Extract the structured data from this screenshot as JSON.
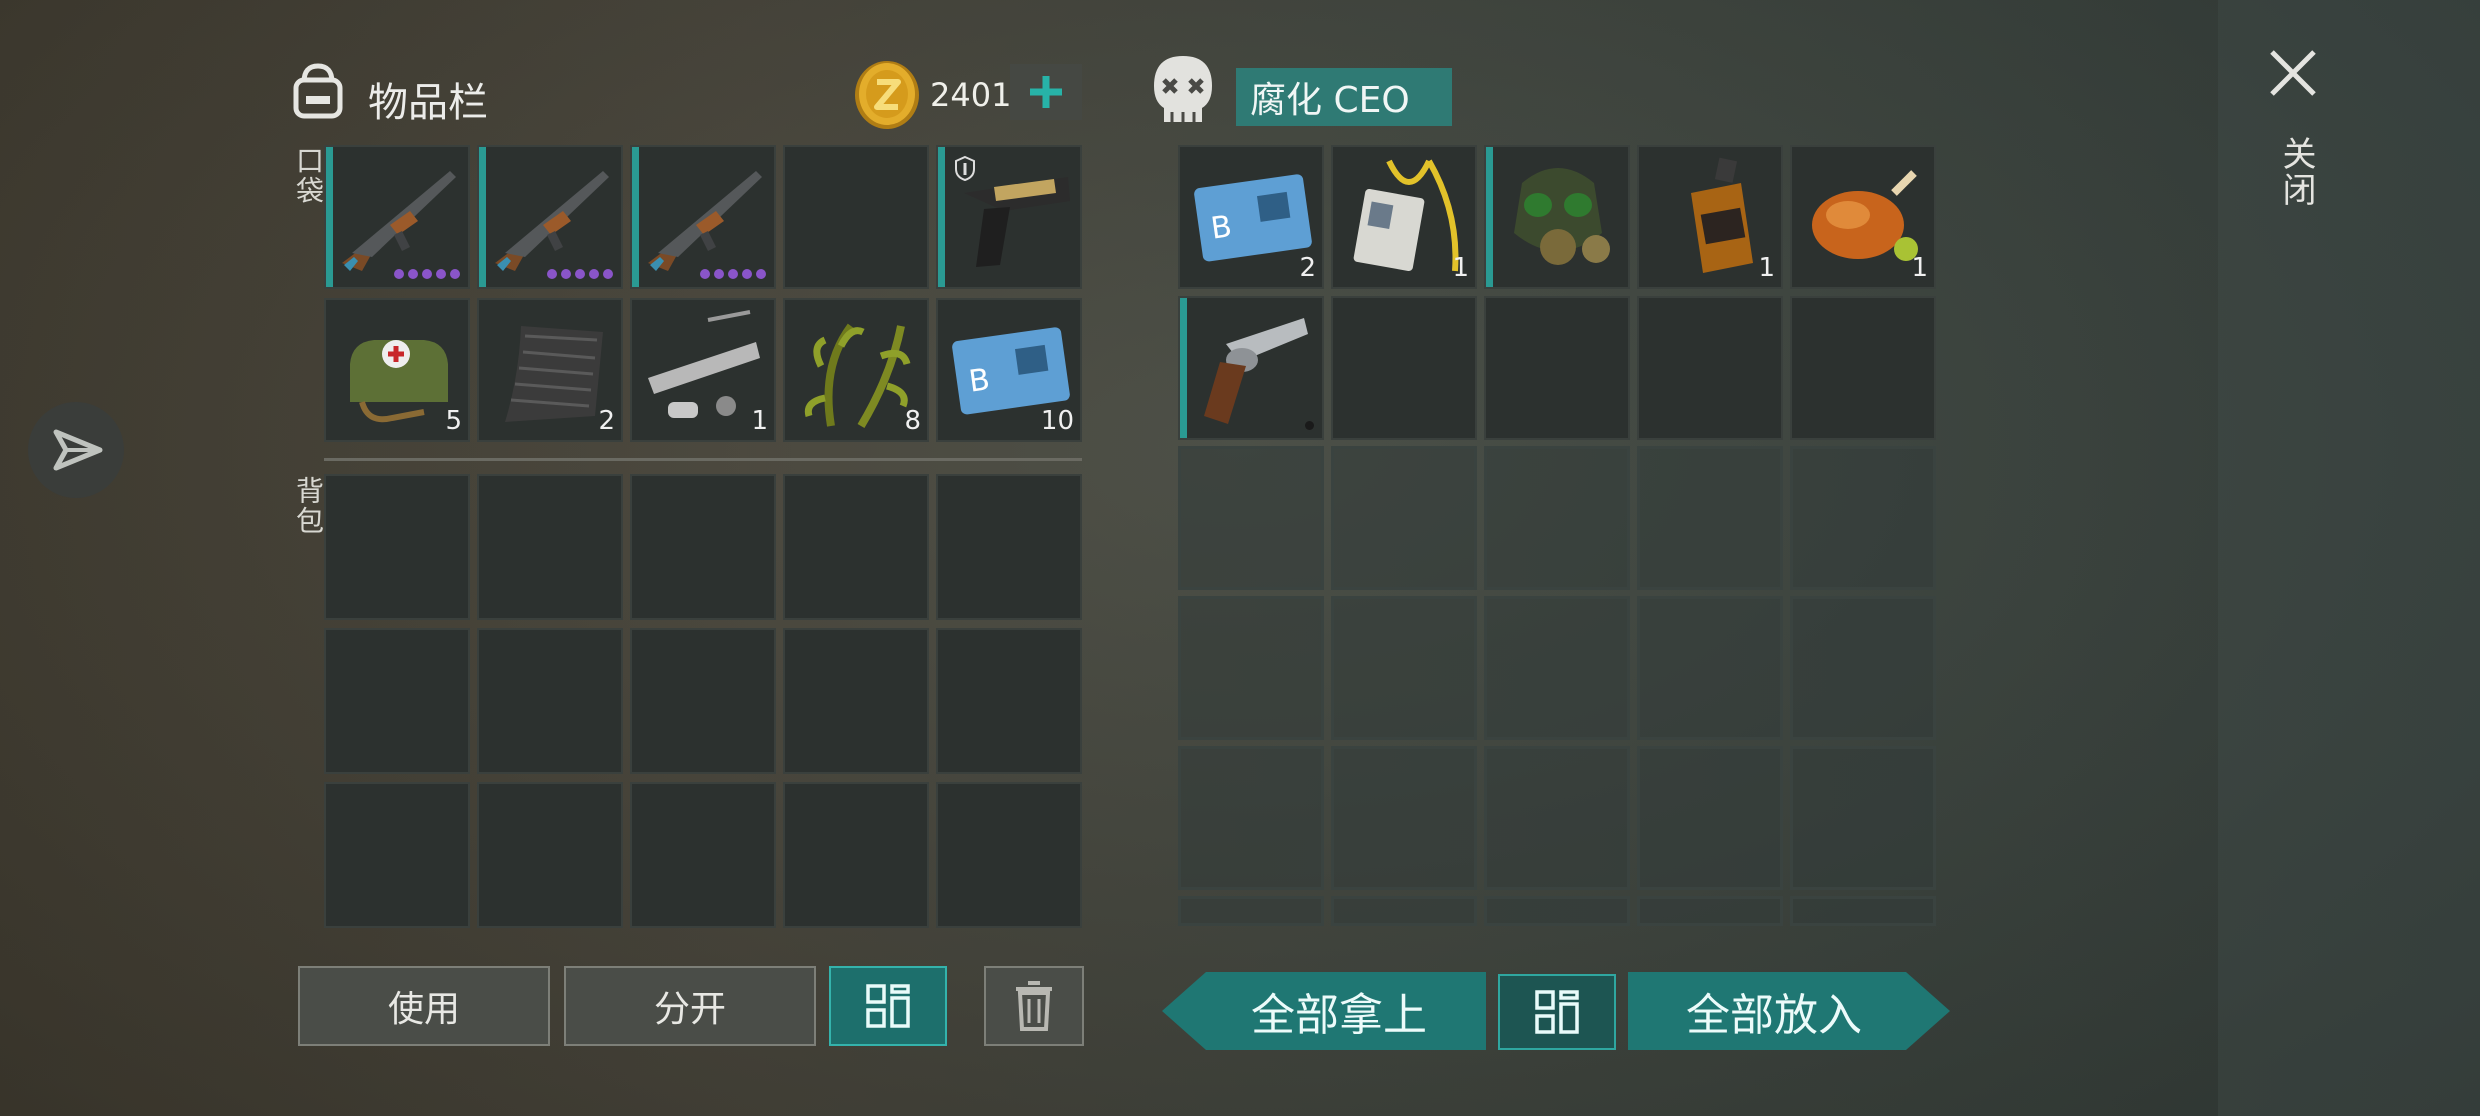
{
  "player": {
    "title": "物品栏",
    "coins": "2401",
    "pocket_label": "口袋",
    "backpack_label": "背包"
  },
  "pocket": [
    {
      "icon": "ak-rifle-icon",
      "count": "",
      "durability_dots": 5,
      "bar": true
    },
    {
      "icon": "ak-rifle-icon",
      "count": "",
      "durability_dots": 5,
      "bar": true
    },
    {
      "icon": "ak-rifle-icon",
      "count": "",
      "durability_dots": 5,
      "bar": true
    },
    {
      "icon": "",
      "count": "",
      "durability_dots": 0,
      "bar": false
    },
    {
      "icon": "pistol-icon",
      "count": "",
      "durability_dots": 0,
      "bar": true
    },
    {
      "icon": "medkit-bag-icon",
      "count": "5"
    },
    {
      "icon": "fabric-sheet-icon",
      "count": "2"
    },
    {
      "icon": "pipe-parts-icon",
      "count": "1"
    },
    {
      "icon": "herb-plant-icon",
      "count": "8"
    },
    {
      "icon": "keycard-b-icon",
      "count": "10"
    }
  ],
  "container": {
    "title": "腐化 CEO",
    "items": [
      {
        "icon": "keycard-b-icon",
        "count": "2"
      },
      {
        "icon": "id-badge-icon",
        "count": "1"
      },
      {
        "icon": "gas-mask-icon",
        "count": ""
      },
      {
        "icon": "whiskey-bottle-icon",
        "count": "1"
      },
      {
        "icon": "roast-chicken-icon",
        "count": "1"
      },
      {
        "icon": "revolver-icon",
        "count": ""
      }
    ]
  },
  "buttons": {
    "use": "使用",
    "split": "分开",
    "take_all": "全部拿上",
    "put_all": "全部放入",
    "close": "关闭"
  },
  "colors": {
    "accent_teal": "#2a9a93",
    "rarity_purple": "#8a55c9",
    "coin_gold": "#d9a521"
  }
}
